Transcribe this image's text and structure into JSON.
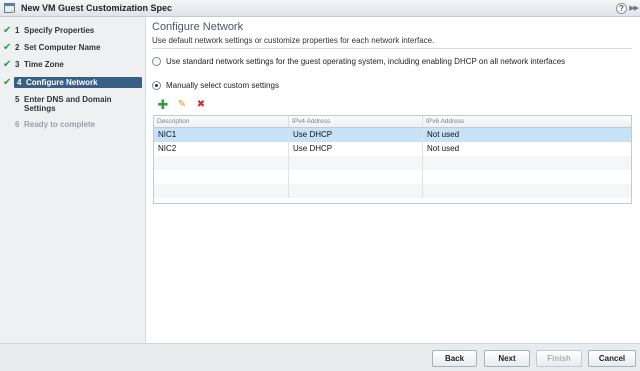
{
  "window": {
    "title": "New VM Guest Customization Spec",
    "help_glyph": "?",
    "expand_glyph": "▶▶"
  },
  "steps": [
    {
      "num": "1",
      "label": "Specify Properties",
      "status": "done"
    },
    {
      "num": "2",
      "label": "Set Computer Name",
      "status": "done"
    },
    {
      "num": "3",
      "label": "Time Zone",
      "status": "done"
    },
    {
      "num": "4",
      "label": "Configure Network",
      "status": "current"
    },
    {
      "num": "5",
      "label": "Enter DNS and Domain Settings",
      "status": "pending"
    },
    {
      "num": "6",
      "label": "Ready to complete",
      "status": "disabled"
    }
  ],
  "main": {
    "heading": "Configure Network",
    "subheading": "Use default network settings or customize properties for each network interface.",
    "option_standard": "Use standard network settings for the guest operating system, including enabling DHCP on all network interfaces",
    "option_custom": "Manually select custom settings",
    "selected_option": "custom"
  },
  "toolbar": {
    "add_glyph": "✚",
    "edit_glyph": "✎",
    "delete_glyph": "✖"
  },
  "table": {
    "columns": [
      "Description",
      "IPv4 Address",
      "IPv6 Address"
    ],
    "rows": [
      [
        "NIC1",
        "Use DHCP",
        "Not used"
      ],
      [
        "NIC2",
        "Use DHCP",
        "Not used"
      ]
    ]
  },
  "footer": {
    "back": "Back",
    "next": "Next",
    "finish": "Finish",
    "cancel": "Cancel"
  },
  "colors": {
    "check": "#2e9c3a",
    "current_step_bg": "#3a5f85",
    "selected_row": "#c6e2f7"
  }
}
